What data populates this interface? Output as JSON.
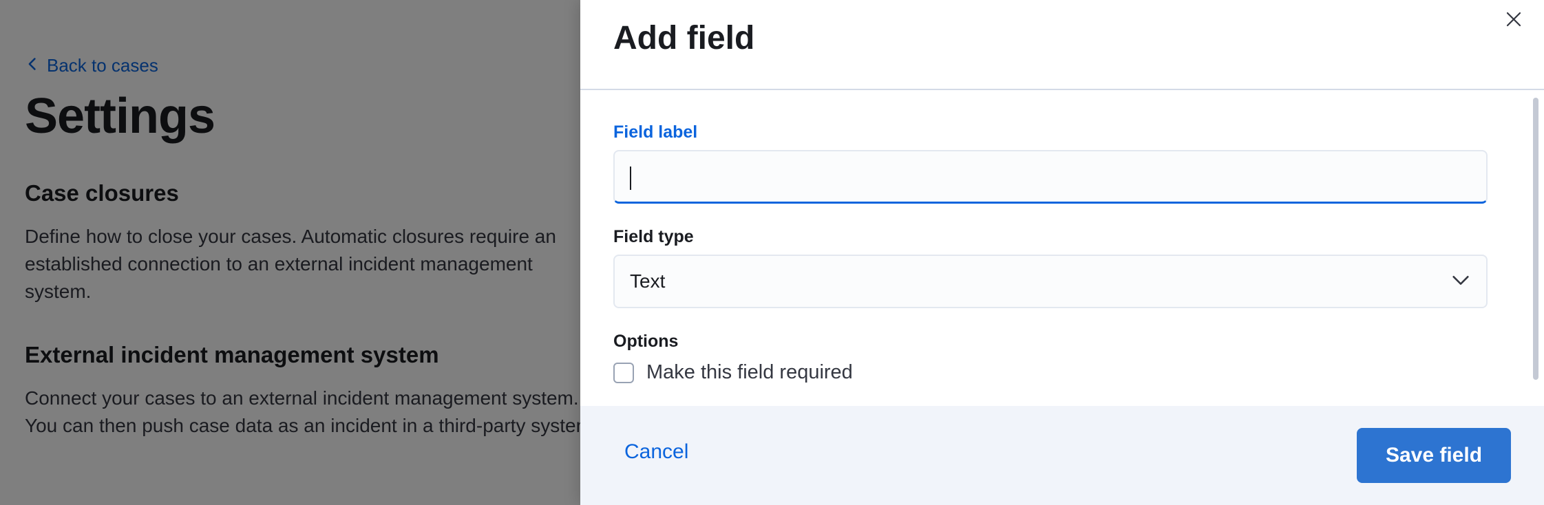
{
  "background": {
    "back_link": "Back to cases",
    "title": "Settings",
    "sections": [
      {
        "title": "Case closures",
        "description": "Define how to close your cases. Automatic closures require an established connection to an external incident management system."
      },
      {
        "title": "External incident management system",
        "description": "Connect your cases to an external incident management system. You can then push case data as an incident in a third-party system."
      }
    ]
  },
  "flyout": {
    "title": "Add field",
    "close_icon": "close-icon",
    "field_label": {
      "label": "Field label",
      "value": ""
    },
    "field_type": {
      "label": "Field type",
      "selected": "Text"
    },
    "options": {
      "label": "Options",
      "required_checkbox": {
        "label": "Make this field required",
        "checked": false
      }
    },
    "footer": {
      "cancel_label": "Cancel",
      "save_label": "Save field"
    }
  },
  "colors": {
    "accent": "#0b64dd",
    "primary_button": "#2d74d1",
    "overlay": "rgba(0,0,0,0.5)",
    "footer_bg": "#f1f4fa"
  }
}
